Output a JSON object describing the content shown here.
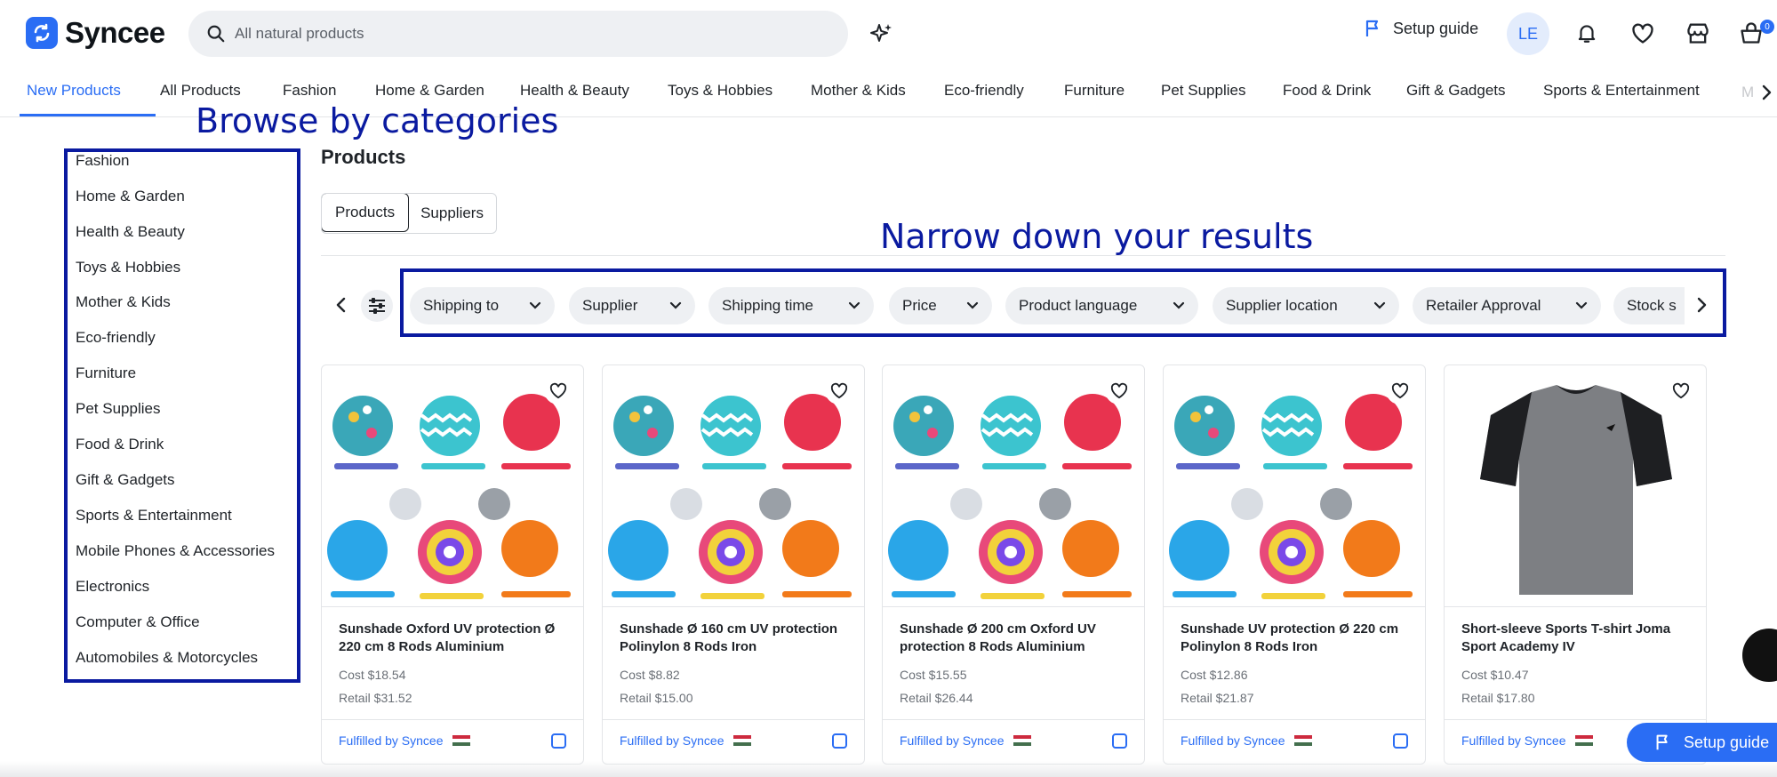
{
  "header": {
    "brand": "Syncee",
    "search_placeholder": "All natural products",
    "setup_guide": "Setup guide",
    "avatar_initials": "LE",
    "cart_count": "0"
  },
  "nav": {
    "tabs": [
      "New Products",
      "All Products",
      "Fashion",
      "Home & Garden",
      "Health & Beauty",
      "Toys & Hobbies",
      "Mother & Kids",
      "Eco-friendly",
      "Furniture",
      "Pet Supplies",
      "Food & Drink",
      "Gift & Gadgets",
      "Sports & Entertainment",
      "M"
    ],
    "active": "New Products"
  },
  "annotations": {
    "browse": "Browse by categories",
    "narrow": "Narrow down your results"
  },
  "sidebar": {
    "items": [
      "Fashion",
      "Home & Garden",
      "Health & Beauty",
      "Toys & Hobbies",
      "Mother & Kids",
      "Eco-friendly",
      "Furniture",
      "Pet Supplies",
      "Food & Drink",
      "Gift & Gadgets",
      "Sports & Entertainment",
      "Mobile Phones & Accessories",
      "Electronics",
      "Computer & Office",
      "Automobiles & Motorcycles"
    ]
  },
  "main": {
    "title": "Products",
    "toggle": [
      "Products",
      "Suppliers"
    ],
    "filters": [
      "Shipping to",
      "Supplier",
      "Shipping time",
      "Price",
      "Product language",
      "Supplier location",
      "Retailer Approval",
      "Stock s"
    ]
  },
  "products": [
    {
      "name": "Sunshade Oxford UV protection Ø 220 cm 8 Rods Aluminium",
      "cost": "Cost $18.54",
      "retail": "Retail $31.52",
      "fulfilled": "Fulfilled by Syncee",
      "image": "umbrellas"
    },
    {
      "name": "Sunshade Ø 160 cm UV protection Polinylon 8 Rods Iron",
      "cost": "Cost $8.82",
      "retail": "Retail $15.00",
      "fulfilled": "Fulfilled by Syncee",
      "image": "umbrellas"
    },
    {
      "name": "Sunshade Ø 200 cm Oxford UV protection 8 Rods Aluminium",
      "cost": "Cost $15.55",
      "retail": "Retail $26.44",
      "fulfilled": "Fulfilled by Syncee",
      "image": "umbrellas"
    },
    {
      "name": "Sunshade UV protection Ø 220 cm Polinylon 8 Rods Iron",
      "cost": "Cost $12.86",
      "retail": "Retail $21.87",
      "fulfilled": "Fulfilled by Syncee",
      "image": "umbrellas"
    },
    {
      "name": "Short-sleeve Sports T-shirt Joma Sport Academy IV",
      "cost": "Cost $10.47",
      "retail": "Retail $17.80",
      "fulfilled": "Fulfilled by Syncee",
      "image": "tshirt"
    }
  ],
  "floating": {
    "setup_guide": "Setup guide"
  },
  "colors": {
    "accent": "#2a6df4",
    "annotation": "#0a1aa0"
  }
}
